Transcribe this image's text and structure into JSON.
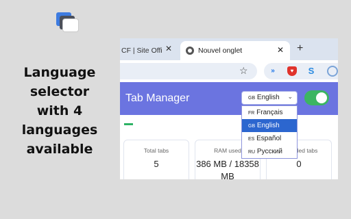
{
  "caption": "Language selector with 4 languages available",
  "browser": {
    "prev_tab_title": "CF | Site Offi",
    "active_tab_title": "Nouvel onglet",
    "close_glyph": "✕",
    "new_tab_glyph": "+",
    "star_glyph": "☆"
  },
  "app": {
    "title": "Tab Manager",
    "language_select": {
      "code": "GB",
      "label": "English",
      "chevron": "⌄"
    },
    "languages": [
      {
        "code": "FR",
        "label": "Français"
      },
      {
        "code": "GB",
        "label": "English"
      },
      {
        "code": "ES",
        "label": "Español"
      },
      {
        "code": "RU",
        "label": "Русский"
      }
    ],
    "selected_language": "English",
    "toggle_on": true,
    "stats": [
      {
        "label": "Total tabs",
        "value": "5"
      },
      {
        "label": "RAM used",
        "value": "386 MB / 18358 MB"
      },
      {
        "label": "Unloaded tabs",
        "value": "0"
      }
    ]
  },
  "colors": {
    "header": "#6b74e0",
    "selected_option": "#2c66cf",
    "toggle": "#3cb562",
    "accent_green": "#2db264"
  },
  "icons": [
    "extension-logo-icon",
    "chrome-icon",
    "star-icon",
    "translate-extension-icon",
    "brave-shield-icon",
    "s-extension-icon",
    "profile-icon"
  ]
}
